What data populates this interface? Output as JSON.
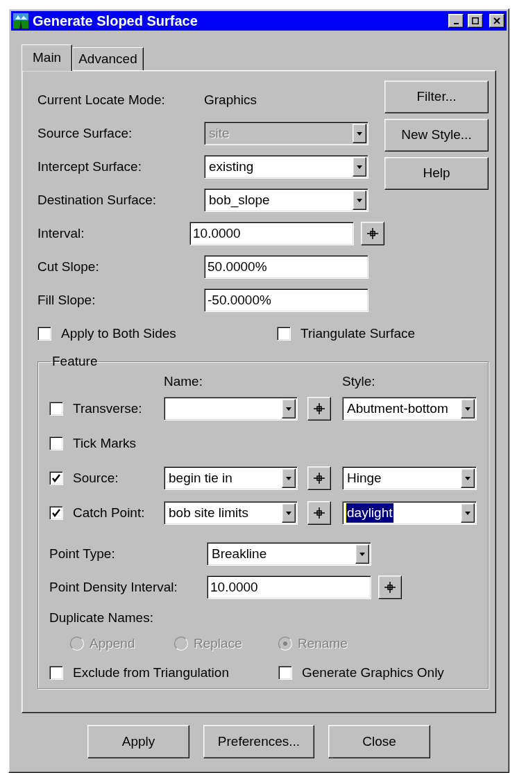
{
  "window": {
    "title": "Generate Sloped Surface"
  },
  "tabs": [
    {
      "label": "Main",
      "selected": true
    },
    {
      "label": "Advanced",
      "selected": false
    }
  ],
  "locate_mode": {
    "label": "Current Locate Mode:",
    "value": "Graphics"
  },
  "fields": [
    {
      "kind": "combo",
      "label": "Source Surface:",
      "value": "site",
      "disabled": true,
      "pick_button": false
    },
    {
      "kind": "combo",
      "label": "Intercept Surface:",
      "value": "existing",
      "disabled": false,
      "pick_button": false
    },
    {
      "kind": "combo",
      "label": "Destination Surface:",
      "value": "bob_slope",
      "disabled": false,
      "pick_button": false
    },
    {
      "kind": "text",
      "label": "Interval:",
      "value": "10.0000",
      "disabled": false,
      "pick_button": true
    },
    {
      "kind": "text",
      "label": "Cut Slope:",
      "value": "50.0000%",
      "disabled": false,
      "pick_button": false
    },
    {
      "kind": "text",
      "label": "Fill Slope:",
      "value": "-50.0000%",
      "disabled": false,
      "pick_button": false
    }
  ],
  "side_buttons": [
    "Filter...",
    "New Style...",
    "Help"
  ],
  "options": [
    {
      "label": "Apply to Both Sides",
      "checked": false
    },
    {
      "label": "Triangulate Surface",
      "checked": false
    }
  ],
  "feature": {
    "title": "Feature",
    "name_header": "Name:",
    "style_header": "Style:",
    "rows": [
      {
        "kind": "full",
        "label": "Transverse:",
        "checked": false,
        "style": "Abutment-bottom",
        "style_highlighted": false
      },
      {
        "kind": "check",
        "label": "Tick Marks",
        "checked": false
      },
      {
        "kind": "full",
        "label": "Source:",
        "checked": true,
        "name": "begin tie in",
        "style": "Hinge",
        "style_highlighted": false
      },
      {
        "kind": "full",
        "label": "Catch Point:",
        "checked": true,
        "name": "bob site limits",
        "style": "daylight",
        "style_highlighted": true
      }
    ],
    "fields": [
      {
        "kind": "combo",
        "label": "Point Type:",
        "value": "Breakline",
        "pick_button": false
      },
      {
        "kind": "text",
        "label": "Point Density Interval:",
        "value": "10.0000",
        "pick_button": true
      }
    ],
    "duplicate_names": {
      "label": "Duplicate Names:",
      "options": [
        {
          "label": "Append",
          "selected": false,
          "disabled": true
        },
        {
          "label": "Replace",
          "selected": false,
          "disabled": true
        },
        {
          "label": "Rename",
          "selected": true,
          "disabled": true
        }
      ]
    },
    "options": [
      {
        "label": "Exclude from Triangulation",
        "checked": false
      },
      {
        "label": "Generate Graphics Only",
        "checked": false
      }
    ]
  },
  "buttons": [
    "Apply",
    "Preferences...",
    "Close"
  ]
}
